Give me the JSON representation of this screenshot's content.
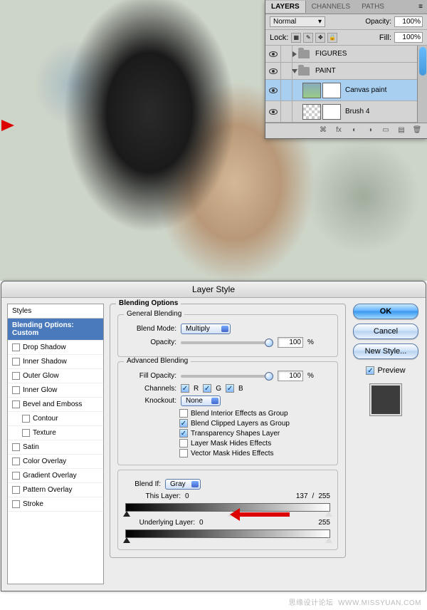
{
  "layers_panel": {
    "tabs": [
      "LAYERS",
      "CHANNELS",
      "PATHS"
    ],
    "blend_mode": "Normal",
    "opacity_label": "Opacity:",
    "opacity_value": "100%",
    "lock_label": "Lock:",
    "fill_label": "Fill:",
    "fill_value": "100%",
    "layers": [
      {
        "type": "group",
        "name": "FIGURES",
        "open": false
      },
      {
        "type": "group",
        "name": "PAINT",
        "open": true
      },
      {
        "type": "layer",
        "name": "Canvas paint",
        "selected": true,
        "indent": 1
      },
      {
        "type": "layer",
        "name": "Brush 4",
        "selected": false,
        "indent": 1
      }
    ]
  },
  "dialog": {
    "title": "Layer Style",
    "styles_header": "Styles",
    "styles_selected": "Blending Options: Custom",
    "styles": [
      "Drop Shadow",
      "Inner Shadow",
      "Outer Glow",
      "Inner Glow",
      "Bevel and Emboss",
      "Contour",
      "Texture",
      "Satin",
      "Color Overlay",
      "Gradient Overlay",
      "Pattern Overlay",
      "Stroke"
    ],
    "blending_options_label": "Blending Options",
    "general_blending_label": "General Blending",
    "blend_mode_label": "Blend Mode:",
    "blend_mode_value": "Multiply",
    "opacity_label": "Opacity:",
    "opacity_value": "100",
    "pct": "%",
    "advanced_blending_label": "Advanced Blending",
    "fill_opacity_label": "Fill Opacity:",
    "fill_opacity_value": "100",
    "channels_label": "Channels:",
    "ch_r": "R",
    "ch_g": "G",
    "ch_b": "B",
    "knockout_label": "Knockout:",
    "knockout_value": "None",
    "adv_checks": [
      {
        "label": "Blend Interior Effects as Group",
        "on": false
      },
      {
        "label": "Blend Clipped Layers as Group",
        "on": true
      },
      {
        "label": "Transparency Shapes Layer",
        "on": true
      },
      {
        "label": "Layer Mask Hides Effects",
        "on": false
      },
      {
        "label": "Vector Mask Hides Effects",
        "on": false
      }
    ],
    "blend_if_label": "Blend If:",
    "blend_if_value": "Gray",
    "this_layer_label": "This Layer:",
    "this_layer_low": "0",
    "this_layer_mid": "137",
    "this_layer_sep": "/",
    "this_layer_high": "255",
    "underlying_label": "Underlying Layer:",
    "underlying_low": "0",
    "underlying_high": "255",
    "buttons": {
      "ok": "OK",
      "cancel": "Cancel",
      "new_style": "New Style..."
    },
    "preview_label": "Preview"
  },
  "watermark_cn": "思缘设计论坛",
  "watermark_url": "WWW.MISSYUAN.COM"
}
